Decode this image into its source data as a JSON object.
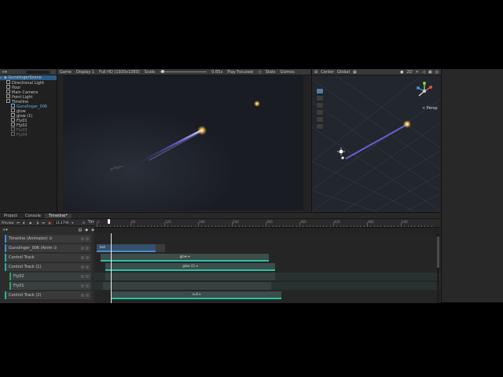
{
  "hierarchy": {
    "scene_name": "GunslingerScene",
    "items": [
      {
        "label": "Directional Light"
      },
      {
        "label": "floor"
      },
      {
        "label": "Main Camera"
      },
      {
        "label": "Point Light"
      },
      {
        "label": "Timeline"
      },
      {
        "label": "Gunslinger_006"
      },
      {
        "label": "glow"
      },
      {
        "label": "glow (1)"
      },
      {
        "label": "Fly01"
      },
      {
        "label": "Fly02"
      },
      {
        "label": "Fly03"
      },
      {
        "label": "Fly04"
      }
    ]
  },
  "game_view": {
    "mode": "Game",
    "display": "Display 1",
    "resolution": "Full HD (1920x1080)",
    "scale_label": "Scale",
    "scale_value": "0.65x",
    "play_mode": "Play Focused",
    "stats": "Stats",
    "gizmos": "Gizmos"
  },
  "scene_view": {
    "pivot": "Center",
    "space": "Global",
    "persp": "< Persp",
    "mode_2d": "2D"
  },
  "bottom_tabs": [
    "Project",
    "Console",
    "Timeline*"
  ],
  "timeline": {
    "preview": "Preview",
    "frame": "14.4799",
    "asset": "Timeline (Timeline)",
    "ruler_labels": [
      "0",
      "60",
      "120",
      "180",
      "240",
      "300",
      "360",
      "420",
      "480",
      "540"
    ],
    "tracks": [
      {
        "label": "Timeline (Animator) ⊙"
      },
      {
        "label": "Gunslinger_006 (Anim ⊙"
      },
      {
        "label": "Control Track"
      },
      {
        "label": "Control Track (1)"
      },
      {
        "label": "Fly02"
      },
      {
        "label": "Fly01"
      },
      {
        "label": "Control Track (2)"
      }
    ],
    "clips": {
      "anim": "bell",
      "control1": "glow",
      "control2": "glow (1)",
      "control3": "null"
    }
  },
  "colors": {
    "control_track": "#27b0a0",
    "anim_track": "#4a8ad0",
    "selection": "#2c5d87"
  }
}
